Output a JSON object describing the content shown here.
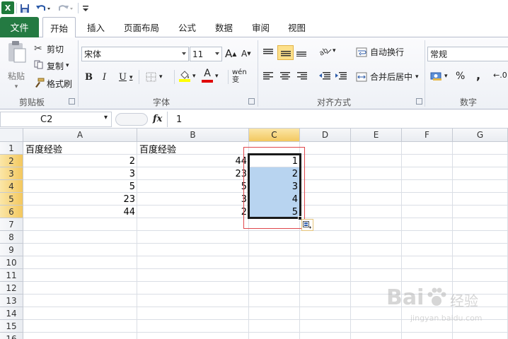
{
  "qat": {
    "app_icon": "X",
    "icons": [
      "save-icon",
      "undo-icon",
      "redo-icon",
      "customize-icon"
    ]
  },
  "tabs": {
    "file": "文件",
    "items": [
      "开始",
      "插入",
      "页面布局",
      "公式",
      "数据",
      "审阅",
      "视图"
    ],
    "active": "开始"
  },
  "ribbon": {
    "clipboard": {
      "paste": "粘贴",
      "cut": "剪切",
      "copy": "复制",
      "format_painter": "格式刷",
      "label": "剪贴板"
    },
    "font": {
      "name": "宋体",
      "size": "11",
      "grow": "A",
      "shrink": "A",
      "bold": "B",
      "italic": "I",
      "underline": "U",
      "font_color_glyph": "A",
      "phonetic": "wén 变",
      "label": "字体"
    },
    "alignment": {
      "wrap_text": "自动换行",
      "merge_center": "合并后居中",
      "label": "对齐方式"
    },
    "number": {
      "format": "常规",
      "percent": "%",
      "comma": ",",
      "label": "数字"
    }
  },
  "formula_bar": {
    "name_box": "C2",
    "fx": "fx",
    "content": "1"
  },
  "sheet": {
    "columns": [
      "A",
      "B",
      "C",
      "D",
      "E",
      "F",
      "G"
    ],
    "rows": [
      "1",
      "2",
      "3",
      "4",
      "5",
      "6",
      "7",
      "8",
      "9",
      "10",
      "11",
      "12",
      "13",
      "14",
      "15",
      "16"
    ],
    "selected_column": "C",
    "selected_rows": [
      "2",
      "3",
      "4",
      "5",
      "6"
    ],
    "cells": {
      "A1": "百度经验",
      "B1": "百度经验",
      "A2": "2",
      "A3": "3",
      "A4": "5",
      "A5": "23",
      "A6": "44",
      "B2": "44",
      "B3": "23",
      "B4": "5",
      "B5": "3",
      "B6": "2",
      "C2": "1",
      "C3": "2",
      "C4": "3",
      "C5": "4",
      "C6": "5"
    }
  },
  "watermark": {
    "brand": "Bai",
    "brand2": "经验",
    "url": "jingyan.baidu.com"
  }
}
